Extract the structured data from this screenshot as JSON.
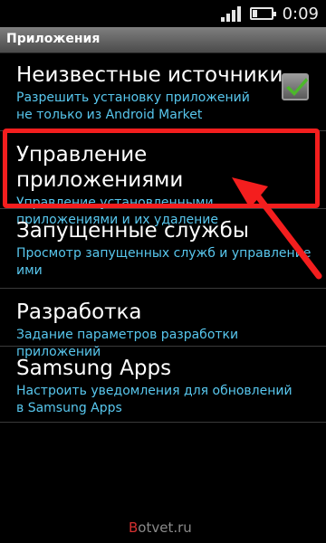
{
  "status_bar": {
    "time": "0:09",
    "signal_icon": "signal-bars-icon",
    "battery_icon": "battery-icon",
    "battery_level": 0.25
  },
  "title_bar": {
    "title": "Приложения"
  },
  "menu": {
    "items": [
      {
        "title": "Неизвестные источники",
        "summary": "Разрешить установку приложений не только из Android Market",
        "checkbox": {
          "checked": true,
          "icon": "checkmark-icon",
          "check_color": "#4cb82a"
        }
      },
      {
        "title": "Управление приложениями",
        "summary": "Управление установленными приложениями и их удаление"
      },
      {
        "title": "Запущенные службы",
        "summary": "Просмотр запущенных служб и управление ими"
      },
      {
        "title": "Разработка",
        "summary": "Задание параметров разработки приложений"
      },
      {
        "title": "Samsung Apps",
        "summary": "Настроить уведомления для обновлений в Samsung Apps"
      }
    ]
  },
  "annotation": {
    "highlight_color": "#f41e1e",
    "arrow_icon": "red-arrow-icon"
  },
  "watermark": {
    "first_letter": "B",
    "rest": "otvet.ru"
  },
  "colors": {
    "background": "#000000",
    "title_text": "#ffffff",
    "summary_text": "#58c7ee",
    "title_bar": "#5e5e5e"
  }
}
